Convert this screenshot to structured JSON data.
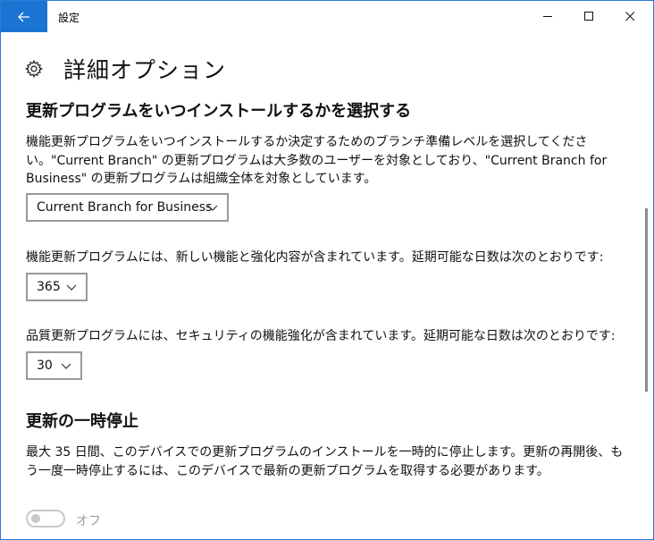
{
  "window": {
    "title": "設定"
  },
  "colors": {
    "accent": "#1a75d2",
    "border": "#2b79d6",
    "disabled": "#c8c8c8"
  },
  "page": {
    "title": "詳細オプション",
    "icon": "gear-icon"
  },
  "branch_section": {
    "heading": "更新プログラムをいつインストールするかを選択する",
    "description": "機能更新プログラムをいつインストールするか決定するためのブランチ準備レベルを選択してください。\"Current Branch\" の更新プログラムは大多数のユーザーを対象としており、\"Current Branch for Business\" の更新プログラムは組織全体を対象としています。",
    "dropdown_value": "Current Branch for Business"
  },
  "feature_updates": {
    "description": "機能更新プログラムには、新しい機能と強化内容が含まれています。延期可能な日数は次のとおりです:",
    "dropdown_value": "365"
  },
  "quality_updates": {
    "description": "品質更新プログラムには、セキュリティの機能強化が含まれています。延期可能な日数は次のとおりです:",
    "dropdown_value": "30"
  },
  "pause_section": {
    "heading": "更新の一時停止",
    "description": "最大 35 日間、このデバイスでの更新プログラムのインストールを一時的に停止します。更新の再開後、もう一度一時停止するには、このデバイスで最新の更新プログラムを取得する必要があります。",
    "toggle_state": "オフ"
  }
}
